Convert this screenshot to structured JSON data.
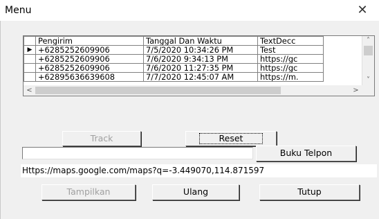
{
  "window": {
    "title": "Menu",
    "close_glyph": "✕"
  },
  "grid": {
    "columns": [
      "Pengirim",
      "Tanggal Dan Waktu",
      "TextDecc"
    ],
    "current_row_marker": "▶",
    "rows": [
      [
        "+6285252609906",
        "7/5/2020 10:34:26 PM",
        "Test"
      ],
      [
        "+6285252609906",
        "7/6/2020 9:34:13 PM",
        "https://gc"
      ],
      [
        "+6285252609906",
        "7/6/2020 11:27:35 PM",
        "https://gc"
      ],
      [
        "+62895636639608",
        "7/7/2020 12:45:07 AM",
        "https://m."
      ]
    ]
  },
  "buttons": {
    "track": "Track",
    "reset": "Reset",
    "buku_telpon": "Buku Telpon",
    "tampilkan": "Tampilkan",
    "ulang": "Ulang",
    "tutup": "Tutup"
  },
  "search_input": {
    "value": ""
  },
  "url_text": "Https://maps.google.com/maps?q=-3.449070,114.871597",
  "icons": {
    "scroll_up": "˄",
    "scroll_down": "˅",
    "scroll_left": "<",
    "scroll_right": ">"
  }
}
